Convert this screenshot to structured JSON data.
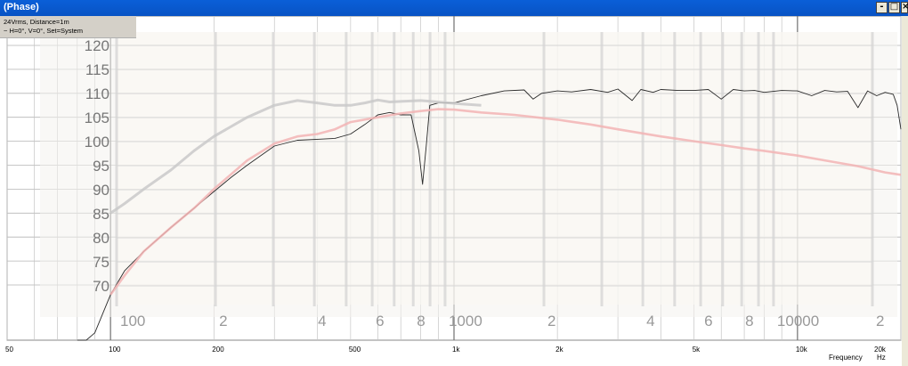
{
  "window": {
    "title": "(Phase)",
    "controls": {
      "minimize": "-",
      "maximize": "□",
      "close": "×"
    }
  },
  "legend": {
    "line1": "24Vrms, Distance=1m",
    "line2": "~  H=0°, V=0°, Set=System"
  },
  "chart_data": [
    {
      "type": "line",
      "title": "",
      "xlabel": "Frequency",
      "xunit": "Hz",
      "x_scale": "log",
      "xlim": [
        50,
        20000
      ],
      "ylim": [
        67,
        122
      ],
      "x_tick_labels": [
        {
          "value": 50,
          "label": "50"
        },
        {
          "value": 100,
          "label": "100"
        },
        {
          "value": 200,
          "label": "200"
        },
        {
          "value": 500,
          "label": "500"
        },
        {
          "value": 1000,
          "label": "1k"
        },
        {
          "value": 2000,
          "label": "2k"
        },
        {
          "value": 5000,
          "label": "5k"
        },
        {
          "value": 10000,
          "label": "10k"
        },
        {
          "value": 20000,
          "label": "20k"
        }
      ],
      "grid": true,
      "series": [
        {
          "color": "#2a2a2a",
          "x": [
            80,
            85,
            90,
            100,
            110,
            125,
            150,
            175,
            200,
            225,
            250,
            300,
            350,
            400,
            450,
            500,
            550,
            600,
            650,
            700,
            750,
            790,
            810,
            830,
            850,
            900,
            1000,
            1200,
            1400,
            1600,
            1700,
            1800,
            2000,
            2200,
            2500,
            2800,
            3000,
            3300,
            3500,
            3800,
            4000,
            4500,
            5000,
            5500,
            6000,
            6500,
            7000,
            7500,
            8000,
            9000,
            10000,
            11000,
            12000,
            13000,
            14000,
            15000,
            16000,
            17000,
            18000,
            19000,
            19500,
            20000
          ],
          "y": [
            40,
            50,
            60,
            68,
            73,
            77,
            82,
            86,
            89.5,
            92.5,
            95,
            99,
            100.2,
            100.4,
            100.6,
            101.5,
            103.5,
            105.5,
            106,
            105.5,
            105.5,
            98,
            91,
            99,
            107.5,
            108,
            108,
            109.5,
            110.5,
            110.7,
            108.8,
            110,
            110.5,
            110.3,
            110.8,
            110.2,
            110.9,
            108.5,
            110.8,
            110.2,
            110.8,
            110.6,
            110.6,
            110.8,
            108.8,
            110.8,
            110.5,
            110.6,
            110.2,
            110.6,
            110.5,
            109.5,
            110.6,
            110.3,
            110.4,
            107,
            110.5,
            109.5,
            110.2,
            109.8,
            107.5,
            102.5
          ]
        },
        {
          "color": "#f2b4b4",
          "x": [
            100,
            110,
            125,
            150,
            175,
            200,
            250,
            300,
            350,
            400,
            450,
            500,
            600,
            700,
            800,
            900,
            1000,
            1200,
            1500,
            2000,
            2500,
            3000,
            4000,
            5000,
            6000,
            7000,
            8000,
            10000,
            12000,
            15000,
            18000,
            20000
          ],
          "y": [
            68,
            72,
            77,
            82,
            86,
            90,
            96,
            99.5,
            101,
            101.5,
            102.5,
            104,
            105,
            105.8,
            106.3,
            106.7,
            106.6,
            106,
            105.5,
            104.5,
            103.5,
            102.5,
            101,
            100,
            99.2,
            98.5,
            98,
            97,
            96,
            94.8,
            93.5,
            93
          ]
        },
        {
          "color": "#c9c9c9",
          "x": [
            100,
            110,
            125,
            150,
            175,
            200,
            250,
            300,
            350,
            400,
            450,
            500,
            550,
            600,
            650,
            700,
            800,
            900,
            1000,
            1100,
            1200
          ],
          "y": [
            85,
            87,
            90,
            94,
            98,
            101,
            105,
            107.5,
            108.5,
            108,
            107.5,
            107.5,
            108,
            108.6,
            108.2,
            108.3,
            108.5,
            108.2,
            107.9,
            107.7,
            107.5
          ]
        }
      ]
    },
    {
      "type": "line",
      "title": "",
      "role": "faint overlay plot",
      "x_scale": "log",
      "y_tick_labels": [
        "120",
        "115",
        "110",
        "105",
        "100",
        "95",
        "90",
        "85",
        "80",
        "75",
        "70"
      ],
      "x_tick_labels": [
        "100",
        "2",
        "4",
        "6",
        "8",
        "1000",
        "2",
        "4",
        "6",
        "8",
        "10000",
        "2"
      ],
      "grid": true
    }
  ]
}
